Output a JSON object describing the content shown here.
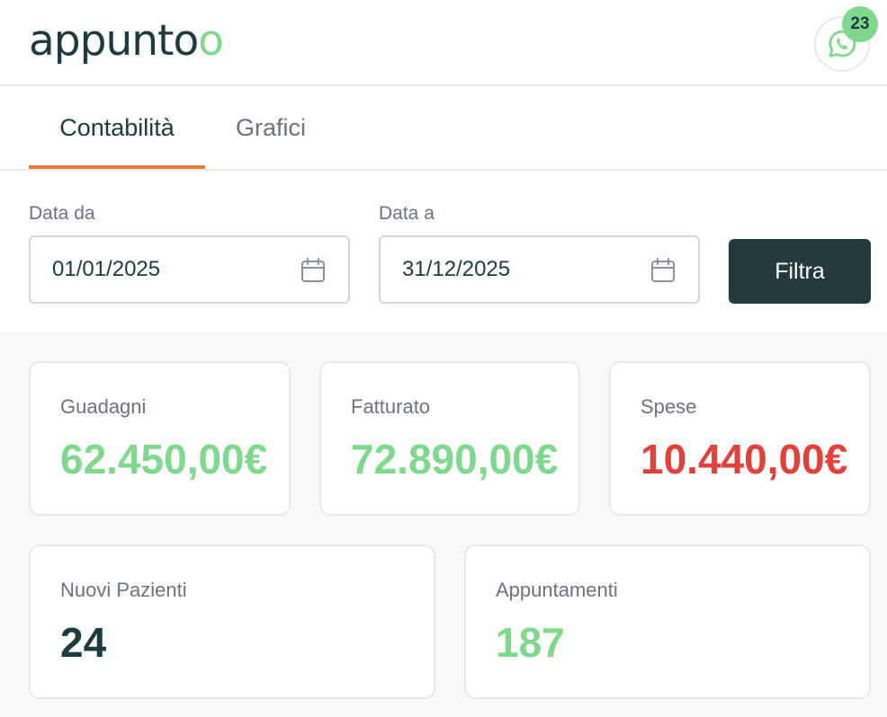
{
  "header": {
    "logo_main": "appunt",
    "logo_o1": "o",
    "logo_o2": "o",
    "whatsapp_badge": "23"
  },
  "tabs": [
    {
      "label": "Contabilità",
      "active": true
    },
    {
      "label": "Grafici",
      "active": false
    }
  ],
  "filters": {
    "from_label": "Data da",
    "from_value": "01/01/2025",
    "to_label": "Data a",
    "to_value": "31/12/2025",
    "button_label": "Filtra"
  },
  "stats": {
    "earnings": {
      "label": "Guadagni",
      "value": "62.450,00€"
    },
    "revenue": {
      "label": "Fatturato",
      "value": "72.890,00€"
    },
    "expenses": {
      "label": "Spese",
      "value": "10.440,00€"
    },
    "new_patients": {
      "label": "Nuovi Pazienti",
      "value": "24"
    },
    "appointments": {
      "label": "Appuntamenti",
      "value": "187"
    }
  },
  "colors": {
    "brand_dark": "#1f3a3d",
    "brand_green": "#7fd88e",
    "accent_orange": "#ec7b34",
    "negative_red": "#e0413b",
    "button_bg": "#233b3e"
  },
  "icons": {
    "whatsapp": "whatsapp-icon",
    "calendar": "calendar-icon"
  }
}
